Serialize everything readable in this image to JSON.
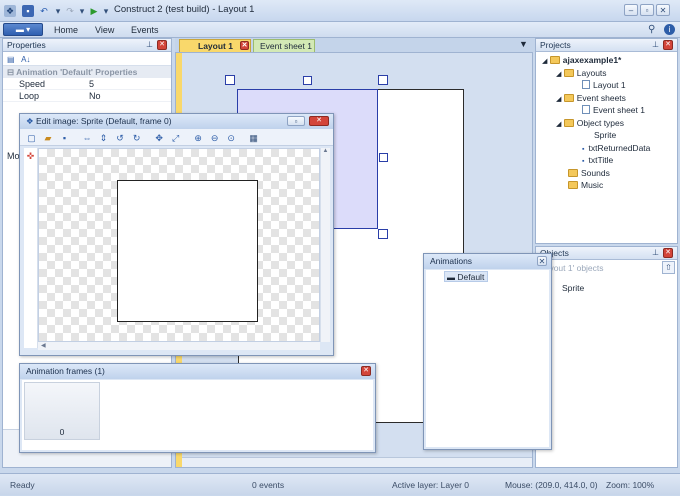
{
  "window": {
    "title": "Construct 2 (test build) - Layout 1"
  },
  "ribbon": {
    "tabs": [
      "Home",
      "View",
      "Events"
    ]
  },
  "properties": {
    "title": "Properties",
    "section": "Animation 'Default' Properties",
    "rows": [
      {
        "name": "Speed",
        "value": "5"
      },
      {
        "name": "Loop",
        "value": "No"
      }
    ],
    "truncated_label": "Mo"
  },
  "doc_tabs": [
    {
      "label": "Layout 1",
      "active": true
    },
    {
      "label": "Event sheet 1",
      "active": false
    }
  ],
  "projects": {
    "title": "Projects",
    "root": "ajaxexample1*",
    "items": [
      {
        "label": "Layouts",
        "kind": "folder",
        "level": 1
      },
      {
        "label": "Layout 1",
        "kind": "doc",
        "level": 2
      },
      {
        "label": "Event sheets",
        "kind": "folder",
        "level": 1
      },
      {
        "label": "Event sheet 1",
        "kind": "doc",
        "level": 2
      },
      {
        "label": "Object types",
        "kind": "folder",
        "level": 1
      },
      {
        "label": "Sprite",
        "kind": "plain",
        "level": 2
      },
      {
        "label": "txtReturnedData",
        "kind": "text",
        "level": 2
      },
      {
        "label": "txtTitle",
        "kind": "text",
        "level": 2
      },
      {
        "label": "Sounds",
        "kind": "folder",
        "level": 1
      },
      {
        "label": "Music",
        "kind": "folder",
        "level": 1
      }
    ]
  },
  "objects": {
    "title": "Objects",
    "filter": "Layout 1' objects",
    "items": [
      "Sprite"
    ]
  },
  "edit_image": {
    "title": "Edit image: Sprite (Default, frame 0)"
  },
  "animations": {
    "title": "Animations",
    "items": [
      "Default"
    ]
  },
  "animation_frames": {
    "title": "Animation frames (1)",
    "frames": [
      "0"
    ]
  },
  "status": {
    "ready": "Ready",
    "events": "0 events",
    "layer": "Active layer: Layer 0",
    "mouse": "Mouse: (209.0, 414.0, 0)",
    "zoom": "Zoom: 100%"
  },
  "colors": {
    "selection_fill": "#dcdcfa",
    "selection_border": "#2a3ea8",
    "active_tab": "#f9d86b",
    "event_tab": "#d3e9b5"
  }
}
